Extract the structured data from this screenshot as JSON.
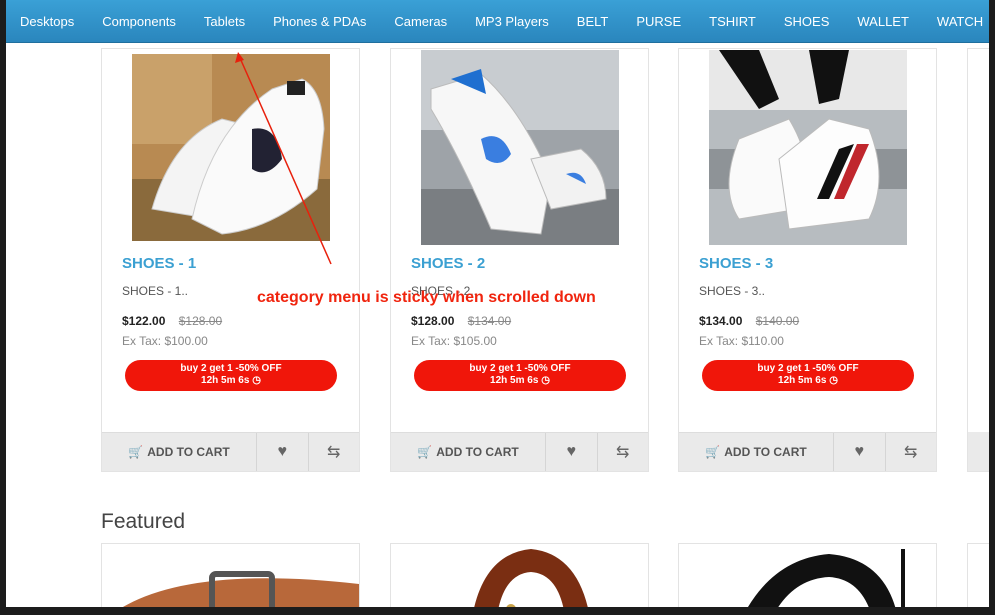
{
  "category_menu": {
    "items": [
      "Desktops",
      "Components",
      "Tablets",
      "Phones & PDAs",
      "Cameras",
      "MP3 Players",
      "BELT",
      "PURSE",
      "TSHIRT",
      "SHOES",
      "WALLET",
      "WATCH"
    ]
  },
  "products": [
    {
      "name": "SHOES - 1",
      "description": "SHOES - 1..",
      "price_new": "$122.00",
      "price_old": "$128.00",
      "tax": "Ex Tax: $100.00",
      "promo_line1": "buy 2 get 1 -50% OFF",
      "promo_line2": "12h 5m 6s",
      "add_to_cart": "ADD TO CART"
    },
    {
      "name": "SHOES - 2",
      "description": "SHOES - 2..",
      "price_new": "$128.00",
      "price_old": "$134.00",
      "tax": "Ex Tax: $105.00",
      "promo_line1": "buy 2 get 1 -50% OFF",
      "promo_line2": "12h 5m 6s",
      "add_to_cart": "ADD TO CART"
    },
    {
      "name": "SHOES - 3",
      "description": "SHOES - 3..",
      "price_new": "$134.00",
      "price_old": "$140.00",
      "tax": "Ex Tax: $110.00",
      "promo_line1": "buy 2 get 1 -50% OFF",
      "promo_line2": "12h 5m 6s",
      "add_to_cart": "ADD TO CART"
    }
  ],
  "featured": {
    "title": "Featured"
  },
  "annotation": {
    "text": "category menu is sticky when scrolled down"
  },
  "colors": {
    "menu_bar": "#2f90c8",
    "product_name": "#3ba0d2",
    "promo": "#f0160a",
    "annotation": "#f0240e"
  }
}
